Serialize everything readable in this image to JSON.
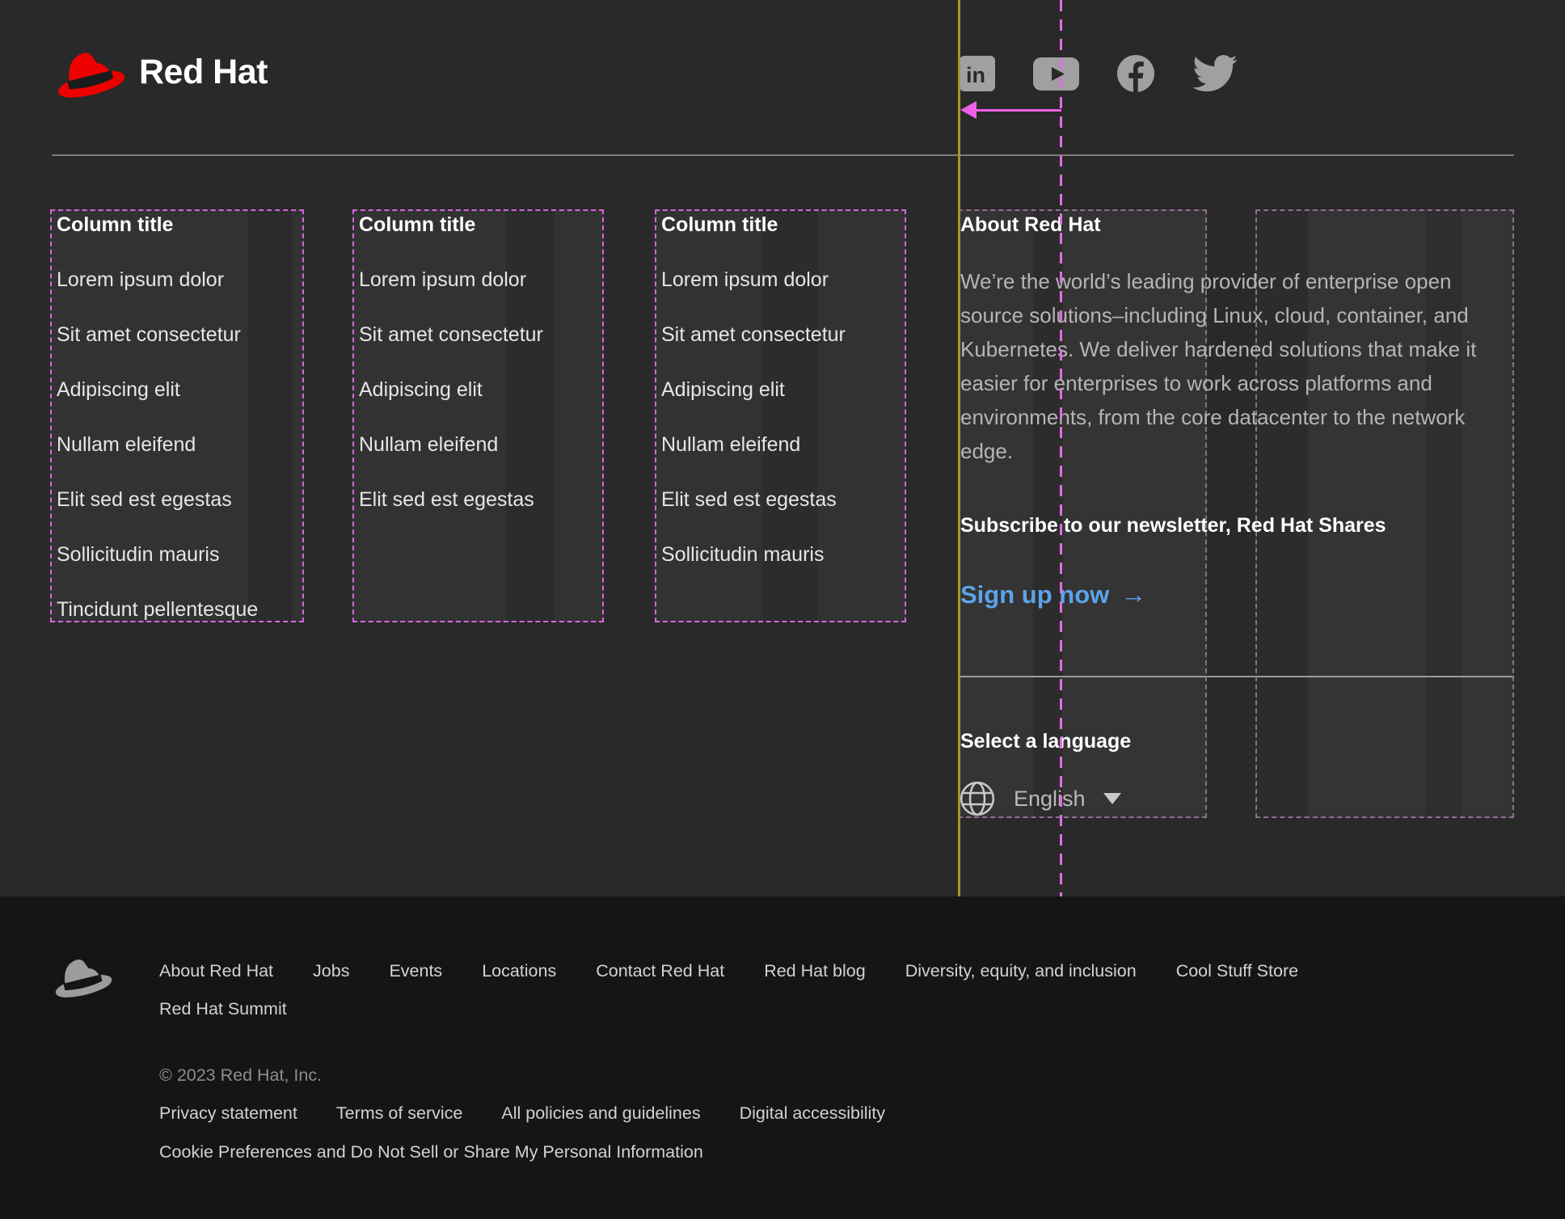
{
  "brand": {
    "wordmark": "Red Hat"
  },
  "social": [
    "linkedin",
    "youtube",
    "facebook",
    "twitter"
  ],
  "columns": [
    {
      "title": "Column title",
      "links": [
        "Lorem ipsum dolor",
        "Sit amet consectetur",
        "Adipiscing elit",
        "Nullam eleifend",
        "Elit sed est egestas",
        "Sollicitudin mauris",
        "Tincidunt pellentesque"
      ]
    },
    {
      "title": "Column title",
      "links": [
        "Lorem ipsum dolor",
        "Sit amet consectetur",
        "Adipiscing elit",
        "Nullam eleifend",
        "Elit sed est egestas"
      ]
    },
    {
      "title": "Column title",
      "links": [
        "Lorem ipsum dolor",
        "Sit amet consectetur",
        "Adipiscing elit",
        "Nullam eleifend",
        "Elit sed est egestas",
        "Sollicitudin mauris"
      ]
    }
  ],
  "about": {
    "title": "About Red Hat",
    "body": "We’re the world’s leading provider of enterprise open source solutions–including Linux, cloud, container, and Kubernetes. We deliver hardened solutions that make it easier for enterprises to work across platforms and environments, from the core datacenter to the network edge.",
    "newsletter_heading": "Subscribe to our newsletter, Red Hat Shares",
    "signup_label": "Sign up now",
    "signup_arrow": "→"
  },
  "language": {
    "heading": "Select a language",
    "selected": "English"
  },
  "footer": {
    "nav": [
      "About Red Hat",
      "Jobs",
      "Events",
      "Locations",
      "Contact Red Hat",
      "Red Hat blog",
      "Diversity, equity, and inclusion",
      "Cool Stuff Store",
      "Red Hat Summit"
    ],
    "copyright": "© 2023 Red Hat, Inc.",
    "legal": [
      "Privacy statement",
      "Terms of service",
      "All policies and guidelines",
      "Digital accessibility"
    ],
    "cookie": "Cookie Preferences and Do Not Sell or Share My Personal Information"
  },
  "colors": {
    "brand_red": "#ee0000",
    "link_blue": "#5ca3e8",
    "bg_main": "#292929",
    "bg_footer": "#151515",
    "annotation_magenta": "#e06ee0",
    "annotation_muted_purple": "#8f6f94",
    "annotation_yellow": "#9e982e",
    "icon_gray": "#a0a0a0",
    "divider_gray": "#7d7d7d"
  }
}
